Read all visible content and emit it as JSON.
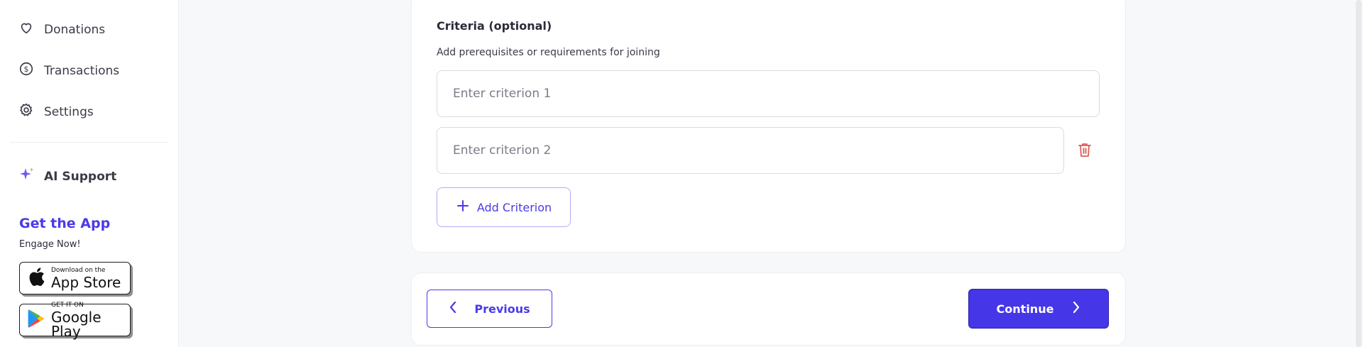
{
  "sidebar": {
    "items": [
      {
        "label": "Donations",
        "icon": "heart-icon"
      },
      {
        "label": "Transactions",
        "icon": "dollar-circle-icon"
      },
      {
        "label": "Settings",
        "icon": "gear-icon"
      }
    ],
    "ai_support": {
      "label": "AI Support",
      "icon": "sparkle-icon"
    },
    "get_app": {
      "title": "Get the App",
      "subtitle": "Engage Now!",
      "app_store": {
        "small": "Download on the",
        "big": "App Store",
        "icon": "apple-icon"
      },
      "google_play": {
        "small": "GET IT ON",
        "big": "Google Play",
        "icon": "google-play-icon"
      }
    }
  },
  "criteria": {
    "title": "Criteria (optional)",
    "subtitle": "Add prerequisites or requirements for joining",
    "inputs": [
      {
        "placeholder": "Enter criterion 1",
        "value": ""
      },
      {
        "placeholder": "Enter criterion 2",
        "value": ""
      }
    ],
    "add_button": "Add Criterion",
    "delete_icon": "trash-icon"
  },
  "footer": {
    "previous_label": "Previous",
    "continue_label": "Continue"
  },
  "colors": {
    "accent": "#4536e8",
    "accent_text": "#4a3ae8",
    "danger": "#e05a5a",
    "background": "#f7f8fa"
  }
}
